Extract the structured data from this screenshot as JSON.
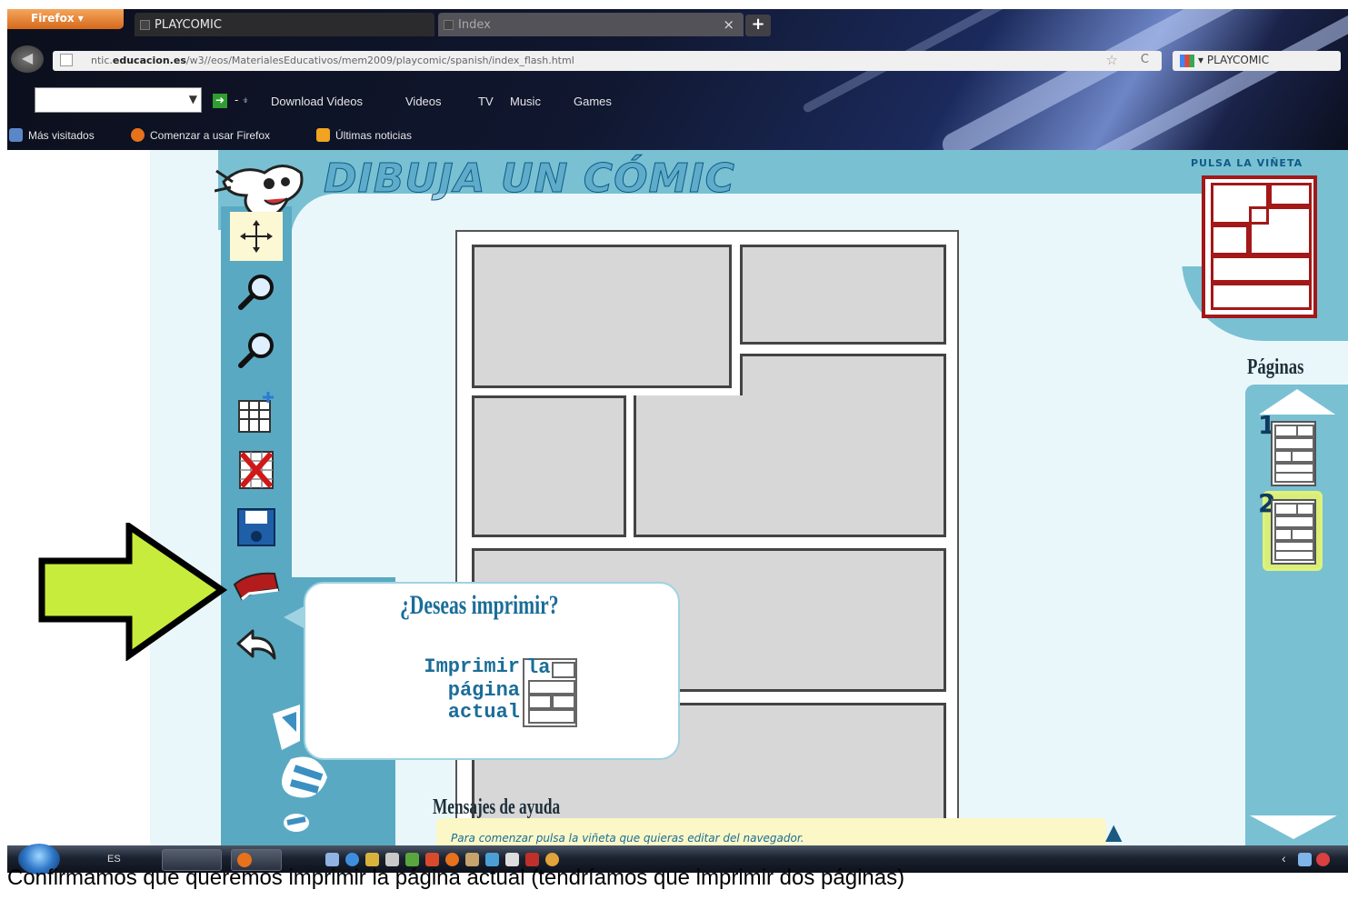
{
  "browser": {
    "firefox_menu": "Firefox",
    "tabs": [
      {
        "label": "PLAYCOMIC"
      },
      {
        "label": "Index"
      }
    ],
    "url": {
      "domain_prefix": "ntic.",
      "domain": "educacion.es",
      "path": "/w3//eos/MaterialesEducativos/mem2009/playcomic/spanish/index_flash.html"
    },
    "search_engine_value": "PLAYCOMIC",
    "toolbar_menus": [
      "Download Videos",
      "Videos",
      "TV",
      "Music",
      "Games"
    ],
    "bookmarks": [
      "Más visitados",
      "Comenzar a usar Firefox",
      "Últimas noticias"
    ]
  },
  "app": {
    "title": "DIBUJA UN CÓMIC",
    "tools": [
      "move-tool",
      "zoom-in-tool",
      "zoom-out-tool",
      "add-grid-tool",
      "delete-tool",
      "save-tool",
      "print-tool",
      "undo-tool"
    ],
    "pulsa_label": "PULSA LA VIÑETA",
    "pages_label": "Páginas",
    "pages": [
      {
        "number": "1"
      },
      {
        "number": "2"
      }
    ],
    "print_dialog": {
      "title": "¿Deseas imprimir?",
      "line1": "Imprimir",
      "line1_suffix": "la",
      "line2": "página",
      "line3": "actual"
    },
    "help": {
      "title": "Mensajes de ayuda",
      "text": "Para comenzar pulsa la viñeta que quieras editar del navegador."
    }
  },
  "taskbar": {
    "language": "ES"
  },
  "caption": "Confirmamos que queremos imprimir la página actual (tendríamos que imprimir dos páginas)",
  "colors": {
    "header": "#79c0d3",
    "tool_column": "#5aa9c3",
    "highlight_arrow": "#c8ec3c",
    "panel_fill": "#d7d7d7",
    "vineta_red": "#a31818"
  }
}
